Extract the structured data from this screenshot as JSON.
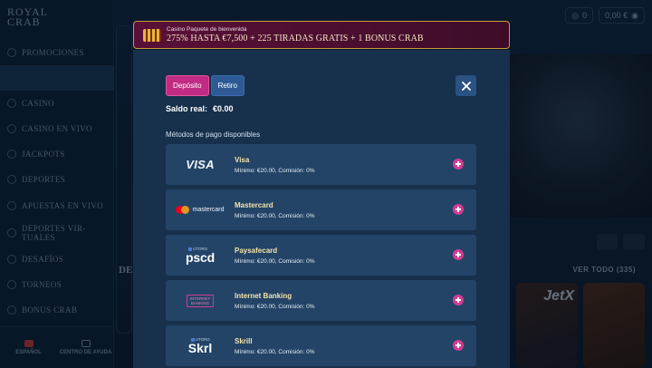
{
  "background": {
    "logo_line1": "ROYAL",
    "logo_line2": "CRAB",
    "nav": [
      "PROMOCIONES",
      "",
      "CASINO",
      "CASINO EN VIVO",
      "JACKPOTS",
      "DEPORTES",
      "APUESTAS EN VIVO",
      "DEPORTES VIR-TUALES",
      "DESAFÍOS",
      "TORNEOS",
      "BONUS CRAB"
    ],
    "bottom_left": "ESPAÑOL",
    "bottom_right": "CENTRO DE AYUDA",
    "balance_pill_1": "0",
    "balance_pill_2": "0,00 €",
    "section_title": "DE",
    "view_all": "VER TODO (335)"
  },
  "promo": {
    "small": "Casino Paquete de bienvenida",
    "big": "275% HASTA €7,500 + 225 TIRADAS GRATIS + 1 BONUS CRAB"
  },
  "modal": {
    "tab_deposit": "Depósito",
    "tab_withdraw": "Retiro",
    "balance_label": "Saldo real:",
    "balance_value": "€0.00",
    "methods_title": "Métodos de pago disponibles",
    "methods": [
      {
        "name": "Visa",
        "desc": "Mínimo: €20.00, Comisión: 0%",
        "logo": "VISA"
      },
      {
        "name": "Mastercard",
        "desc": "Mínimo: €20.00, Comisión: 0%",
        "logo": "mastercard"
      },
      {
        "name": "Paysafecard",
        "desc": "Mínimo: €20.00, Comisión: 0%",
        "logo": "pscd",
        "logo_top": "UTORG"
      },
      {
        "name": "Internet Banking",
        "desc": "Mínimo: €20.00, Comisión: 0%",
        "logo_l1": "INTERNET",
        "logo_l2": "BANKING"
      },
      {
        "name": "Skrill",
        "desc": "Mínimo: €20.00, Comisión: 0%",
        "logo": "Skrl",
        "logo_top": "UTORG"
      }
    ]
  },
  "colors": {
    "accent_pink": "#c12b84",
    "accent_blue": "#2d5a94",
    "method_bg": "#234467",
    "modal_bg": "#17304c",
    "method_name": "#f4e3a8"
  }
}
